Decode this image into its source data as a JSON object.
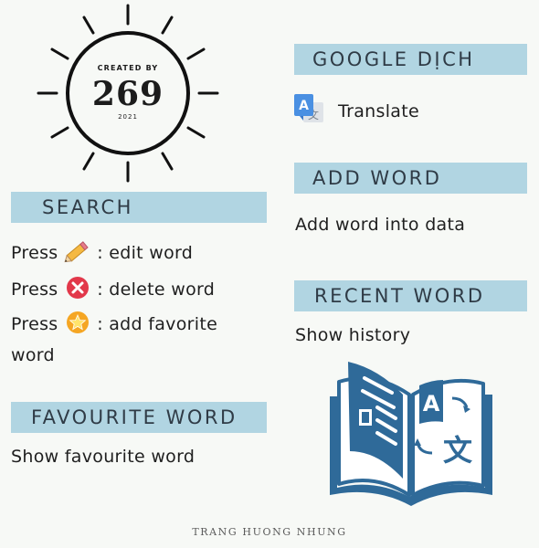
{
  "logo": {
    "created_by": "CREATED BY",
    "number": "269",
    "year": "2021"
  },
  "sections": {
    "search": {
      "title": "SEARCH",
      "line1_press": "Press",
      "line1_action": ":  edit word",
      "line2_press": "Press",
      "line2_action": ":  delete word",
      "line3_press": "Press",
      "line3_action": ":  add favorite",
      "line4": "word"
    },
    "favourite": {
      "title": "FAVOURITE WORD",
      "desc": "Show favourite word"
    },
    "google": {
      "title": "GOOGLE DỊCH",
      "translate_label": "Translate"
    },
    "add_word": {
      "title": "ADD  WORD",
      "desc": "Add word into data"
    },
    "recent": {
      "title": "RECENT  WORD",
      "desc": "Show history"
    }
  },
  "icons": {
    "edit": "pencil-icon",
    "delete": "delete-x-icon",
    "favorite": "star-icon",
    "translate": "google-translate-icon",
    "book": "translation-book-icon"
  },
  "colors": {
    "header_bg": "#b1d5e2",
    "book_blue": "#2f6a99",
    "delete_red": "#e2384a",
    "star_orange": "#f5a623"
  },
  "footer": "TRANG HUONG NHUNG"
}
